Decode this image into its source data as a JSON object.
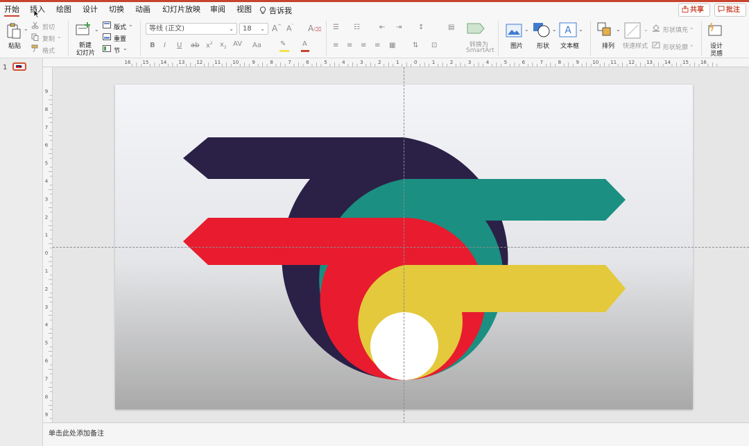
{
  "tabs": [
    {
      "label": "开始",
      "active": true
    },
    {
      "label": "插入"
    },
    {
      "label": "绘图"
    },
    {
      "label": "设计"
    },
    {
      "label": "切换"
    },
    {
      "label": "动画"
    },
    {
      "label": "幻灯片放映"
    },
    {
      "label": "审阅"
    },
    {
      "label": "视图"
    }
  ],
  "tell_me": "告诉我",
  "share_label": "共享",
  "comments_label": "批注",
  "ribbon": {
    "paste": "粘贴",
    "cut": "剪切",
    "copy": "复制",
    "format": "格式",
    "new_slide_line1": "新建",
    "new_slide_line2": "幻灯片",
    "layout": "版式",
    "reset": "重置",
    "section": "节",
    "font_name": "等线 (正文)",
    "font_size": "18",
    "convert_line1": "转换为",
    "convert_line2": "SmartArt",
    "picture": "图片",
    "shape": "形状",
    "textbox": "文本框",
    "arrange": "排列",
    "quick_styles": "快速样式",
    "shape_fill": "形状填充",
    "shape_outline": "形状轮廓",
    "designer_line1": "设计",
    "designer_line2": "灵感"
  },
  "slide_number": "1",
  "notes_placeholder": "单击此处添加备注",
  "ruler_h_labels": [
    "16",
    "15",
    "14",
    "13",
    "12",
    "11",
    "10",
    "9",
    "8",
    "7",
    "6",
    "5",
    "4",
    "3",
    "2",
    "1",
    "0",
    "1",
    "2",
    "3",
    "4",
    "5",
    "6",
    "7",
    "8",
    "9",
    "10",
    "11",
    "12",
    "13",
    "14",
    "15",
    "16"
  ],
  "ruler_v_labels": [
    "9",
    "8",
    "7",
    "6",
    "5",
    "4",
    "3",
    "2",
    "1",
    "0",
    "1",
    "2",
    "3",
    "4",
    "5",
    "6",
    "7",
    "8",
    "9"
  ],
  "colors": {
    "accent": "#c9442e",
    "navy": "#2b2147",
    "teal": "#1b8f82",
    "red": "#e81c2e",
    "yellow": "#e3c93b",
    "white": "#ffffff"
  }
}
